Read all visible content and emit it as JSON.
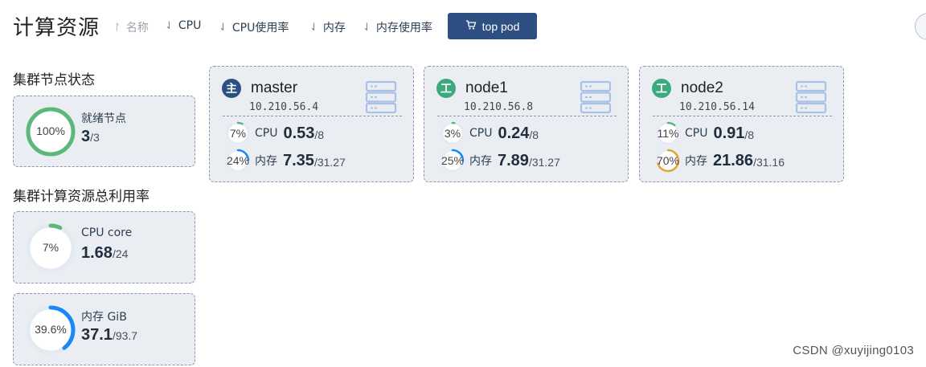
{
  "header": {
    "title": "计算资源",
    "sort_items": [
      {
        "arrow": "↾",
        "label": "名称",
        "muted": true
      },
      {
        "arrow": "⇃",
        "label": "CPU",
        "muted": false
      },
      {
        "arrow": "⇃",
        "label": "CPU使用率",
        "muted": false
      },
      {
        "arrow": "⇃",
        "label": "内存",
        "muted": false
      },
      {
        "arrow": "⇃",
        "label": "内存使用率",
        "muted": false
      }
    ],
    "top_pod_label": "top pod"
  },
  "cluster_node_status": {
    "title": "集群节点状态",
    "ready": {
      "label": "就绪节点",
      "percent_text": "100%",
      "percent": 100,
      "value": "3",
      "total": "/3",
      "color": "#5cb87a"
    }
  },
  "cluster_usage": {
    "title": "集群计算资源总利用率",
    "cpu": {
      "label": "CPU core",
      "percent_text": "7%",
      "percent": 7,
      "value": "1.68",
      "total": "/24",
      "color": "#5cb87a"
    },
    "memory": {
      "label": "内存 GiB",
      "percent_text": "39.6%",
      "percent": 39.6,
      "value": "37.1",
      "total": "/93.7",
      "color": "#1989fa"
    }
  },
  "nodes": [
    {
      "badge": "主",
      "badge_color": "#2e4f82",
      "name": "master",
      "ip": "10.210.56.4",
      "cpu": {
        "label": "CPU",
        "percent_text": "7%",
        "percent": 7,
        "value": "0.53",
        "total": "/8",
        "color": "#5cb87a"
      },
      "mem": {
        "label": "内存",
        "percent_text": "24%",
        "percent": 24,
        "value": "7.35",
        "total": "/31.27",
        "color": "#1989fa"
      }
    },
    {
      "badge": "工",
      "badge_color": "#3daa7e",
      "name": "node1",
      "ip": "10.210.56.8",
      "cpu": {
        "label": "CPU",
        "percent_text": "3%",
        "percent": 3,
        "value": "0.24",
        "total": "/8",
        "color": "#5cb87a"
      },
      "mem": {
        "label": "内存",
        "percent_text": "25%",
        "percent": 25,
        "value": "7.89",
        "total": "/31.27",
        "color": "#1989fa"
      }
    },
    {
      "badge": "工",
      "badge_color": "#3daa7e",
      "name": "node2",
      "ip": "10.210.56.14",
      "cpu": {
        "label": "CPU",
        "percent_text": "11%",
        "percent": 11,
        "value": "0.91",
        "total": "/8",
        "color": "#5cb87a"
      },
      "mem": {
        "label": "内存",
        "percent_text": "70%",
        "percent": 70,
        "value": "21.86",
        "total": "/31.16",
        "color": "#e6a23c"
      }
    }
  ],
  "watermark": "CSDN @xuyijing0103",
  "colors": {
    "accent": "#2e4f82",
    "card_bg": "#eaeef3",
    "ring_track": "#e5e9f2"
  }
}
